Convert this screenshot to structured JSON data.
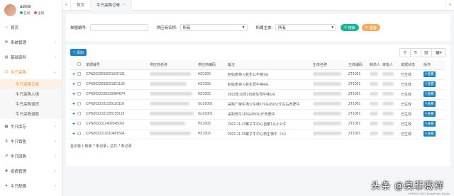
{
  "user": {
    "name": "admin",
    "status_online": "在线",
    "logout": "注销",
    "online_color": "#1ab394",
    "logout_color": "#ed5565"
  },
  "menu": [
    {
      "label": "首页",
      "icon": "home-icon",
      "glyph": "⌂"
    },
    {
      "label": "系统管理",
      "icon": "gear-icon",
      "glyph": "⚙"
    },
    {
      "label": "基础资料",
      "icon": "book-icon",
      "glyph": "▤"
    },
    {
      "label": "牛只采购",
      "icon": "cart-icon",
      "glyph": "☐"
    },
    {
      "label": "牛只库存",
      "icon": "box-icon",
      "glyph": "▦"
    },
    {
      "label": "牛只销售",
      "icon": "sale-icon",
      "glyph": "$"
    },
    {
      "label": "牛只回购",
      "icon": "return-icon",
      "glyph": "↺"
    },
    {
      "label": "疫病管理",
      "icon": "medical-icon",
      "glyph": "✚"
    },
    {
      "label": "牛只配偶",
      "icon": "heart-icon",
      "glyph": "♥"
    }
  ],
  "submenu": [
    "牛只采购订单",
    "牛只采购入场",
    "牛只采购退货",
    "牛只采购退款"
  ],
  "topbar": {
    "back_icon": "«",
    "home_tab": "首页",
    "active_tab": "牛只采购订单",
    "forward_icon": "»",
    "close_icon": "×"
  },
  "search": {
    "order_label": "单据编号:",
    "supplier_label": "供应商名称:",
    "supplier_value": "所有",
    "entity_label": "所属主体:",
    "entity_value": "所有",
    "search_btn": "搜索",
    "reset_btn": "重置"
  },
  "toolbar": {
    "add_label": "添加",
    "tool_icons": [
      "search-icon",
      "refresh-icon",
      "columns-icon",
      "grid-icon"
    ],
    "tool_glyphs": [
      "⚲",
      "↻",
      "▥",
      "▦▾"
    ]
  },
  "table": {
    "columns": [
      "单据编号",
      "供应商名称",
      "供应商编码",
      "备注",
      "主体名称",
      "主体编码",
      "制单人",
      "审批人",
      "单据状态",
      "操作"
    ],
    "rows": [
      {
        "code": "CPN2022093021625131",
        "supplier_code": "HZ1003",
        "note": "初始表将入新生公牛犊1头",
        "entity_code": "ZT1001",
        "status": "已生效",
        "action": "查看"
      },
      {
        "code": "CPN2022093021821133",
        "supplier_code": "HZ1003",
        "note": "初始表将入新生母牛犊4头",
        "entity_code": "ZT1001",
        "status": "已生效",
        "action": "查看"
      },
      {
        "code": "CPN2022100319384674",
        "supplier_code": "HZ1003",
        "note": "2022年10月3日新生母牛犊1头",
        "entity_code": "ZT1001",
        "status": "已生效",
        "action": "查看"
      },
      {
        "code": "CPN2022101155110118",
        "supplier_code": "GL01001",
        "note": "采购广荣牛场公牛犊170头650公斤左右育肥牛",
        "entity_code": "ZT1001",
        "status": "已生效",
        "action": "查看"
      },
      {
        "code": "CPN2022101155735119",
        "supplier_code": "GL01001",
        "note": "采购育牛183头650公斤育肥中",
        "entity_code": "ZT1001",
        "status": "已生效",
        "action": "查看"
      },
      {
        "code": "CPN2022111409345002",
        "supplier_code": "HZ1003",
        "note": "2022-11-13繁子牛中心自繁1头小公牛",
        "entity_code": "ZT1001",
        "status": "已生效",
        "action": "查看"
      },
      {
        "code": "CPN2022111610481504",
        "supplier_code": "HZ1003",
        "note": "2022-11-15繁子牛中心新生犊牛（公）",
        "entity_code": "ZT1001",
        "status": "已生效",
        "action": "查看"
      }
    ]
  },
  "pagination": "显示第 1 到第 7 条记录，总共 7 条记录",
  "watermark": {
    "main": "头条 @奥菲薇祥",
    "sub": "SPRING 2023 RudiaForto Studio"
  }
}
